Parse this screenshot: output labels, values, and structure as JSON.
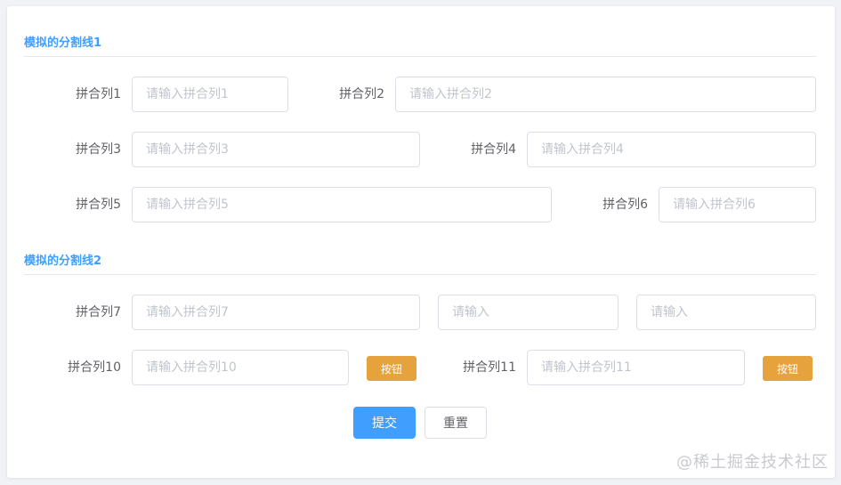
{
  "section1": {
    "title": "模拟的分割线1"
  },
  "section2": {
    "title": "模拟的分割线2"
  },
  "fields": {
    "f1": {
      "label": "拼合列1",
      "placeholder": "请输入拼合列1"
    },
    "f2": {
      "label": "拼合列2",
      "placeholder": "请输入拼合列2"
    },
    "f3": {
      "label": "拼合列3",
      "placeholder": "请输入拼合列3"
    },
    "f4": {
      "label": "拼合列4",
      "placeholder": "请输入拼合列4"
    },
    "f5": {
      "label": "拼合列5",
      "placeholder": "请输入拼合列5"
    },
    "f6": {
      "label": "拼合列6",
      "placeholder": "请输入拼合列6"
    },
    "f7": {
      "label": "拼合列7",
      "placeholder": "请输入拼合列7"
    },
    "f8": {
      "placeholder": "请输入"
    },
    "f9": {
      "placeholder": "请输入"
    },
    "f10": {
      "label": "拼合列10",
      "placeholder": "请输入拼合列10",
      "button": "按钮"
    },
    "f11": {
      "label": "拼合列11",
      "placeholder": "请输入拼合列11",
      "button": "按钮"
    }
  },
  "actions": {
    "submit": "提交",
    "reset": "重置"
  },
  "watermark": "@稀土掘金技术社区",
  "colors": {
    "primary": "#409eff",
    "warning": "#e6a23c"
  }
}
